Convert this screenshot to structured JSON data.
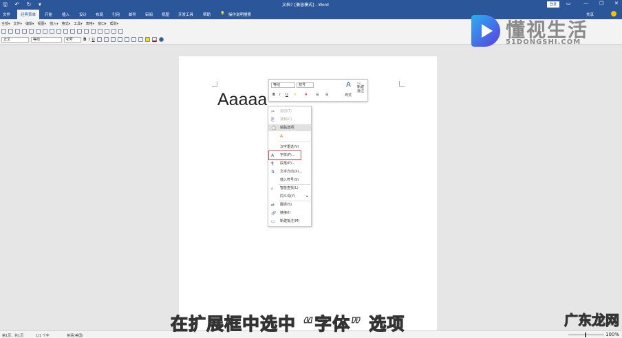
{
  "titlebar": {
    "title": "文档7 [兼容模式] - Word",
    "login": "登录",
    "quick_access": "🖫 ↶ ↻ ▾",
    "min": "—",
    "restore": "❐",
    "close": "✕",
    "ribbon_display": "▭"
  },
  "tabs": [
    "文件",
    "经典菜单",
    "开始",
    "插入",
    "设计",
    "布局",
    "引用",
    "邮件",
    "审阅",
    "视图",
    "开发工具",
    "帮助"
  ],
  "tell_me": "操作说明搜索",
  "share": "共享",
  "classic_menu": [
    "全部▾",
    "文件▾",
    "编辑▾",
    "视图▾",
    "插入▾",
    "格式▾",
    "工具▾",
    "表格▾",
    "窗口▾",
    "帮助▾"
  ],
  "ribbon": {
    "style": "正文",
    "font": "等线",
    "size": "初号",
    "bold": "B",
    "italic": "I",
    "underline": "U"
  },
  "document": {
    "text": "Aaaaa"
  },
  "mini_toolbar": {
    "font": "等线",
    "size": "初号",
    "bold": "B",
    "italic": "I",
    "underline": "U",
    "styles": "样式",
    "new_comment": "新建批注"
  },
  "context_menu": [
    {
      "label": "剪切(T)",
      "icon": "scissors-icon",
      "glyph": "✂",
      "disabled": true
    },
    {
      "label": "复制(C)",
      "icon": "copy-icon",
      "glyph": "⎘",
      "disabled": true
    },
    {
      "label": "粘贴选项:",
      "icon": "paste-icon",
      "glyph": "📋",
      "disabled": false
    },
    {
      "label": "",
      "icon": "paste-text-only-icon",
      "glyph": "A",
      "disabled": false
    },
    {
      "label": "汉字重选(V)",
      "icon": "",
      "glyph": "",
      "disabled": false
    },
    {
      "label": "字体(F)...",
      "icon": "font-icon",
      "glyph": "A",
      "disabled": false
    },
    {
      "label": "段落(P)...",
      "icon": "paragraph-icon",
      "glyph": "¶",
      "disabled": false
    },
    {
      "label": "文字方向(X)...",
      "icon": "text-direction-icon",
      "glyph": "⇅",
      "disabled": false
    },
    {
      "label": "插入符号(S)",
      "icon": "",
      "glyph": "",
      "disabled": false
    },
    {
      "label": "智能查找(L)",
      "icon": "search-icon",
      "glyph": "⌕",
      "disabled": false
    },
    {
      "label": "同义词(Y)",
      "icon": "",
      "glyph": "",
      "disabled": false,
      "submenu": "▸"
    },
    {
      "label": "翻译(S)",
      "icon": "translate-icon",
      "glyph": "⇄",
      "disabled": false
    },
    {
      "label": "链接(I)",
      "icon": "link-icon",
      "glyph": "🔗",
      "disabled": false
    },
    {
      "label": "新建批注(M)",
      "icon": "comment-icon",
      "glyph": "▭",
      "disabled": false
    }
  ],
  "status": {
    "page": "第1页，共1页",
    "words": "1/1 个字",
    "lang": "英语(美国)",
    "zoom": "100%"
  },
  "subtitle": "在扩展框中选中 “字体” 选项",
  "watermark": {
    "cn": "懂视生活",
    "en": "51DONGSHI.COM",
    "bottom": "广东龙网",
    "bottom2": "生活"
  }
}
